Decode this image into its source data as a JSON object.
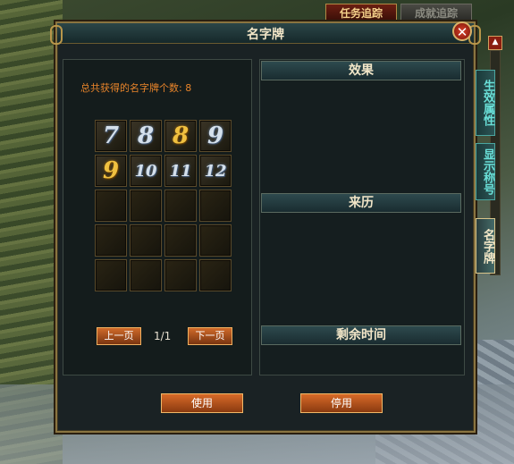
{
  "quest_buttons": {
    "active": "任务追踪",
    "dim": "成就追踪"
  },
  "panel": {
    "title": "名字牌",
    "close_symbol": "✕",
    "count_label": "总共获得的名字牌个数: 8",
    "slots": [
      {
        "glyph": "7",
        "style": "silver"
      },
      {
        "glyph": "8",
        "style": "silver"
      },
      {
        "glyph": "8",
        "style": "gold"
      },
      {
        "glyph": "9",
        "style": "silver"
      },
      {
        "glyph": "9",
        "style": "gold"
      },
      {
        "glyph": "10",
        "style": "silver"
      },
      {
        "glyph": "11",
        "style": "silver"
      },
      {
        "glyph": "12",
        "style": "silver"
      },
      {
        "glyph": "",
        "style": ""
      },
      {
        "glyph": "",
        "style": ""
      },
      {
        "glyph": "",
        "style": ""
      },
      {
        "glyph": "",
        "style": ""
      },
      {
        "glyph": "",
        "style": ""
      },
      {
        "glyph": "",
        "style": ""
      },
      {
        "glyph": "",
        "style": ""
      },
      {
        "glyph": "",
        "style": ""
      },
      {
        "glyph": "",
        "style": ""
      },
      {
        "glyph": "",
        "style": ""
      },
      {
        "glyph": "",
        "style": ""
      },
      {
        "glyph": "",
        "style": ""
      }
    ],
    "prev_page": "上一页",
    "page_indicator": "1/1",
    "next_page": "下一页",
    "sections": {
      "effect": "效果",
      "source": "来历",
      "remaining_time": "剩余时间"
    },
    "use_button": "使用",
    "stop_button": "停用"
  },
  "side_tabs": [
    "生效属性",
    "显示称号",
    "名字牌"
  ],
  "colors": {
    "accent_gold": "#8a7440",
    "count_text": "#e8842a",
    "tab_text": "#6ae0d8"
  }
}
